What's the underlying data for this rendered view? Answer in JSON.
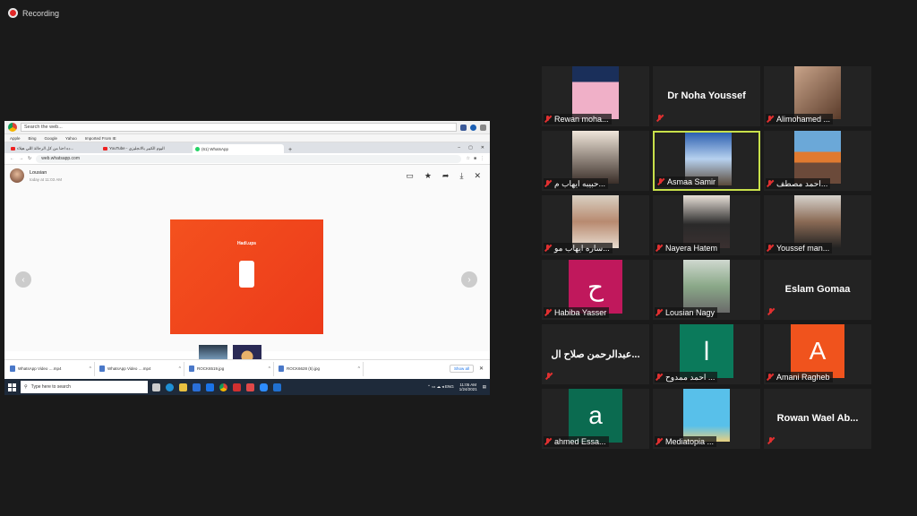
{
  "recording": {
    "label": "Recording"
  },
  "shared_screen": {
    "ie_search": "Search the web...",
    "bookmarks": [
      "Apple",
      "Bing",
      "Google",
      "Yahoo",
      "Imported From IE"
    ],
    "tabs": [
      "ده احنا من كل الرحالة اللي هيلاء...",
      "YouTube - اليوم الكبير بالانجليزي",
      "(61) WhatsApp"
    ],
    "window_controls": [
      "–",
      "▢",
      "✕"
    ],
    "url": "web.whatsapp.com",
    "viewer": {
      "sender": "Lousian",
      "time": "today at 11:03 AM"
    },
    "image_title": "Hadi.ups",
    "downloads": [
      "WhatsApp Video ....mp4",
      "WhatsApp Video ....mp4",
      "ROCK6519.jpg",
      "ROCK6628 (5).jpg"
    ],
    "show_all": "Show all",
    "taskbar": {
      "search_placeholder": "Type here to search",
      "time": "11:05 AM",
      "date": "1/24/2021"
    }
  },
  "participants": [
    {
      "name": "Rewan moha...",
      "type": "video"
    },
    {
      "name": "Dr Noha Youssef",
      "type": "text"
    },
    {
      "name": "Alimohamed ...",
      "type": "video"
    },
    {
      "name": "حبيبه ايهاب م...",
      "type": "video"
    },
    {
      "name": "Asmaa Samir",
      "type": "video",
      "speaking": true
    },
    {
      "name": "احمد مصطف...",
      "type": "video"
    },
    {
      "name": "ساره ايهاب مو...",
      "type": "video"
    },
    {
      "name": "Nayera Hatem",
      "type": "video"
    },
    {
      "name": "Youssef man...",
      "type": "video"
    },
    {
      "name": "Habiba Yasser",
      "type": "avatar",
      "letter": "ح",
      "color": "#c0185c"
    },
    {
      "name": "Lousian Nagy",
      "type": "video"
    },
    {
      "name": "Eslam Gomaa",
      "type": "text"
    },
    {
      "name": "عبدالرحمن صلاح ال...",
      "type": "text"
    },
    {
      "name": "احمد ممدوح ...",
      "type": "avatar",
      "letter": "ا",
      "color": "#0b7a5b"
    },
    {
      "name": "Amani Ragheb",
      "type": "avatar",
      "letter": "A",
      "color": "#f0531d"
    },
    {
      "name": "ahmed Essa...",
      "type": "avatar",
      "letter": "a",
      "color": "#0b6b50"
    },
    {
      "name": "Mediatopia ...",
      "type": "video"
    },
    {
      "name": "Rowan Wael Ab...",
      "type": "text"
    }
  ],
  "colors": {
    "background": "#1a1a1a",
    "tile": "#232323",
    "speaker_border": "#c8e04a",
    "muted_mic": "#e03030"
  }
}
